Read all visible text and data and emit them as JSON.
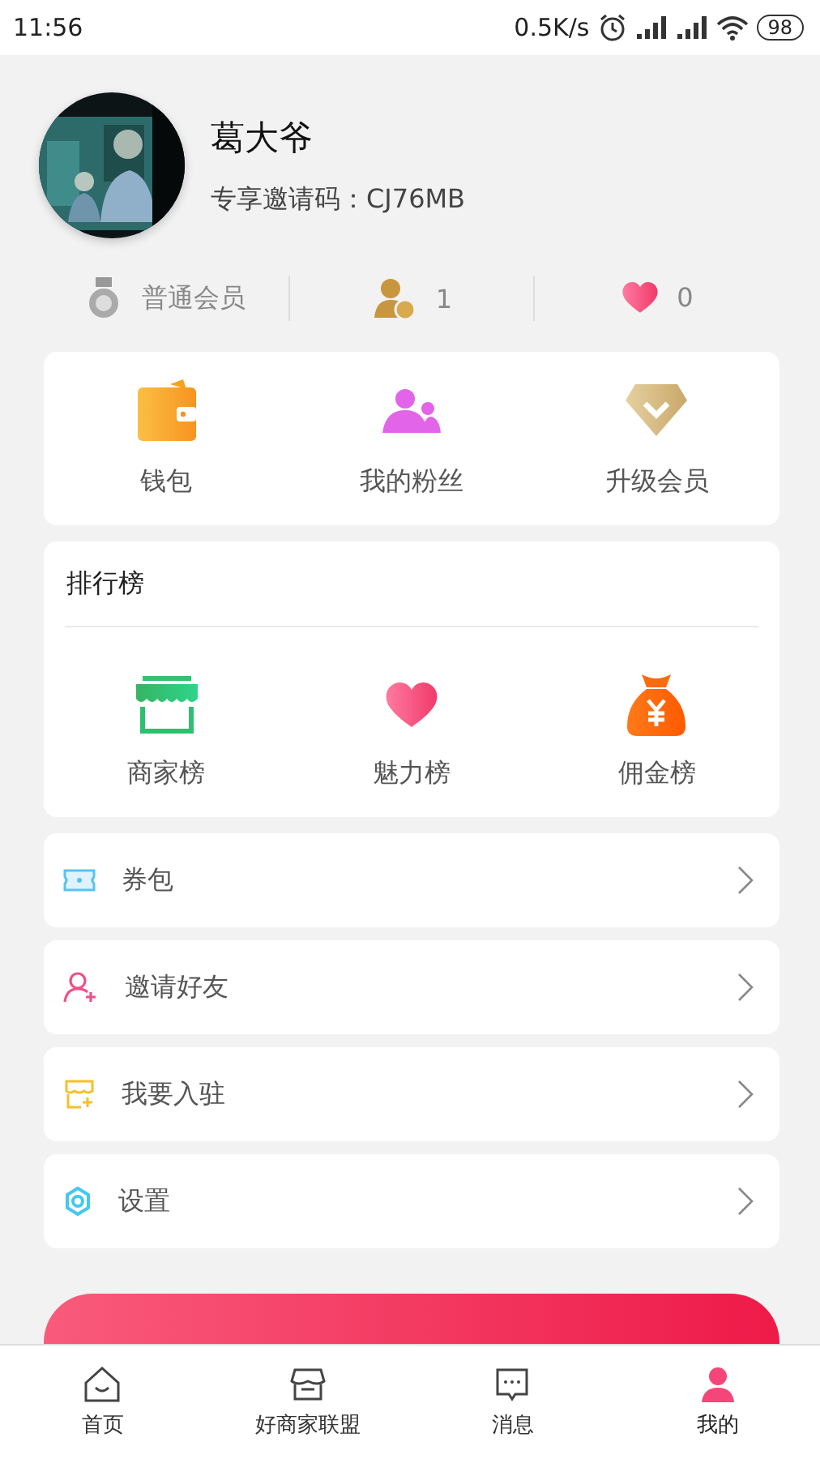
{
  "status_bar": {
    "time": "11:56",
    "speed": "0.5K/s",
    "battery": "98"
  },
  "profile": {
    "name": "葛大爷",
    "invite_code": "专享邀请码：CJ76MB"
  },
  "stats": [
    {
      "kind": "medal",
      "text": "普通会员"
    },
    {
      "kind": "fans",
      "text": "1"
    },
    {
      "kind": "heart",
      "text": "0"
    }
  ],
  "shortcuts": [
    {
      "kind": "wallet",
      "label": "钱包"
    },
    {
      "kind": "fans",
      "label": "我的粉丝"
    },
    {
      "kind": "diamond",
      "label": "升级会员"
    }
  ],
  "ranking": {
    "title": "排行榜",
    "items": [
      {
        "kind": "shop",
        "label": "商家榜"
      },
      {
        "kind": "heart",
        "label": "魅力榜"
      },
      {
        "kind": "moneybag",
        "label": "佣金榜"
      }
    ]
  },
  "menu": [
    {
      "kind": "ticket",
      "label": "券包"
    },
    {
      "kind": "invite",
      "label": "邀请好友"
    },
    {
      "kind": "join",
      "label": "我要入驻"
    },
    {
      "kind": "settings",
      "label": "设置"
    }
  ],
  "tab_bar": [
    {
      "kind": "home",
      "label": "首页",
      "selected": false
    },
    {
      "kind": "shop",
      "label": "好商家联盟",
      "selected": false
    },
    {
      "kind": "message",
      "label": "消息",
      "selected": false
    },
    {
      "kind": "me",
      "label": "我的",
      "selected": true
    }
  ]
}
